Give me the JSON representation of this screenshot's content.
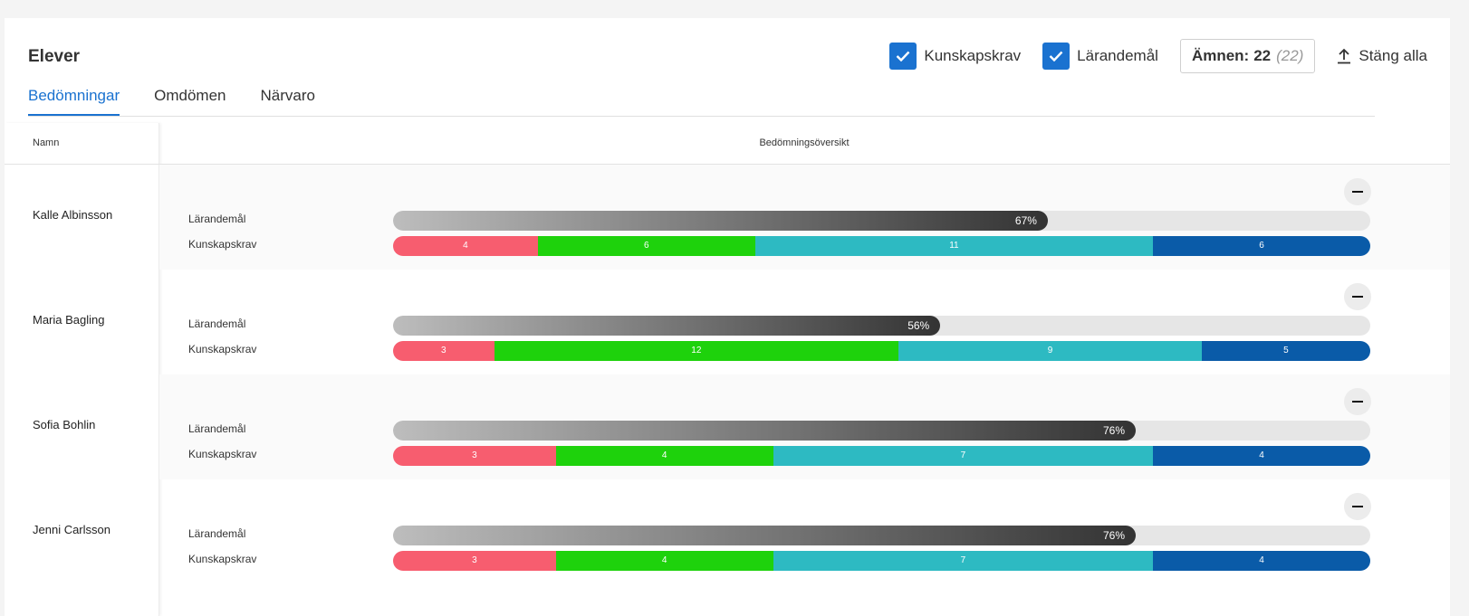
{
  "header": {
    "title": "Elever",
    "checkbox_kunskapskrav": "Kunskapskrav",
    "checkbox_larandemal": "Lärandemål",
    "subjects_label": "Ämnen:",
    "subjects_value": "22",
    "subjects_total": "(22)",
    "close_all": "Stäng alla"
  },
  "tabs": [
    "Bedömningar",
    "Omdömen",
    "Närvaro"
  ],
  "columns": {
    "name": "Namn",
    "overview": "Bedömningsöversikt"
  },
  "labels": {
    "goal": "Lärandemål",
    "requirements": "Kunskapskrav"
  },
  "colors": {
    "seg": [
      "#f75d6f",
      "#1ed20c",
      "#2dbac2",
      "#0a5ba8"
    ],
    "accent": "#1a72d0"
  },
  "students": [
    {
      "name": "Kalle Albinsson",
      "goal_pct": 67,
      "goal_text": "67%",
      "segments": [
        4,
        6,
        11,
        6
      ]
    },
    {
      "name": "Maria Bagling",
      "goal_pct": 56,
      "goal_text": "56%",
      "segments": [
        3,
        12,
        9,
        5
      ]
    },
    {
      "name": "Sofia Bohlin",
      "goal_pct": 76,
      "goal_text": "76%",
      "segments": [
        3,
        4,
        7,
        4
      ]
    },
    {
      "name": "Jenni Carlsson",
      "goal_pct": 76,
      "goal_text": "76%",
      "segments": [
        3,
        4,
        7,
        4
      ]
    }
  ],
  "icons": {
    "checkbox": "check-icon",
    "close_all": "upload-icon",
    "collapse": "minus-icon"
  }
}
